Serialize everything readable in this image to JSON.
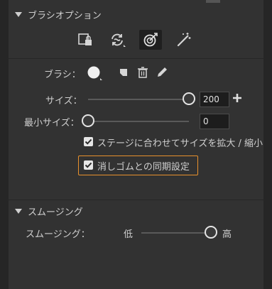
{
  "brush_options": {
    "title": "ブラシオプション",
    "tools": [
      "lock-layer-icon",
      "smoothing-rotate-icon",
      "pressure-target-icon",
      "magic-wand-brush-icon"
    ],
    "active_tool_index": 2,
    "brush_label": "ブラシ：",
    "size": {
      "label": "サイズ：",
      "value": "200",
      "fraction": 1.0
    },
    "min_size": {
      "label": "最小サイズ：",
      "value": "0",
      "fraction": 0.0
    },
    "scale_with_stage": {
      "label": "ステージに合わせてサイズを拡大 / 縮小",
      "checked": true
    },
    "erase_same": {
      "label": "消しゴムとの同期設定",
      "checked": true
    }
  },
  "smoothing": {
    "title": "スムージング",
    "label": "スムージング：",
    "min_label": "低",
    "max_label": "高",
    "fraction": 1.0
  },
  "colors": {
    "highlight": "#e8912d"
  }
}
